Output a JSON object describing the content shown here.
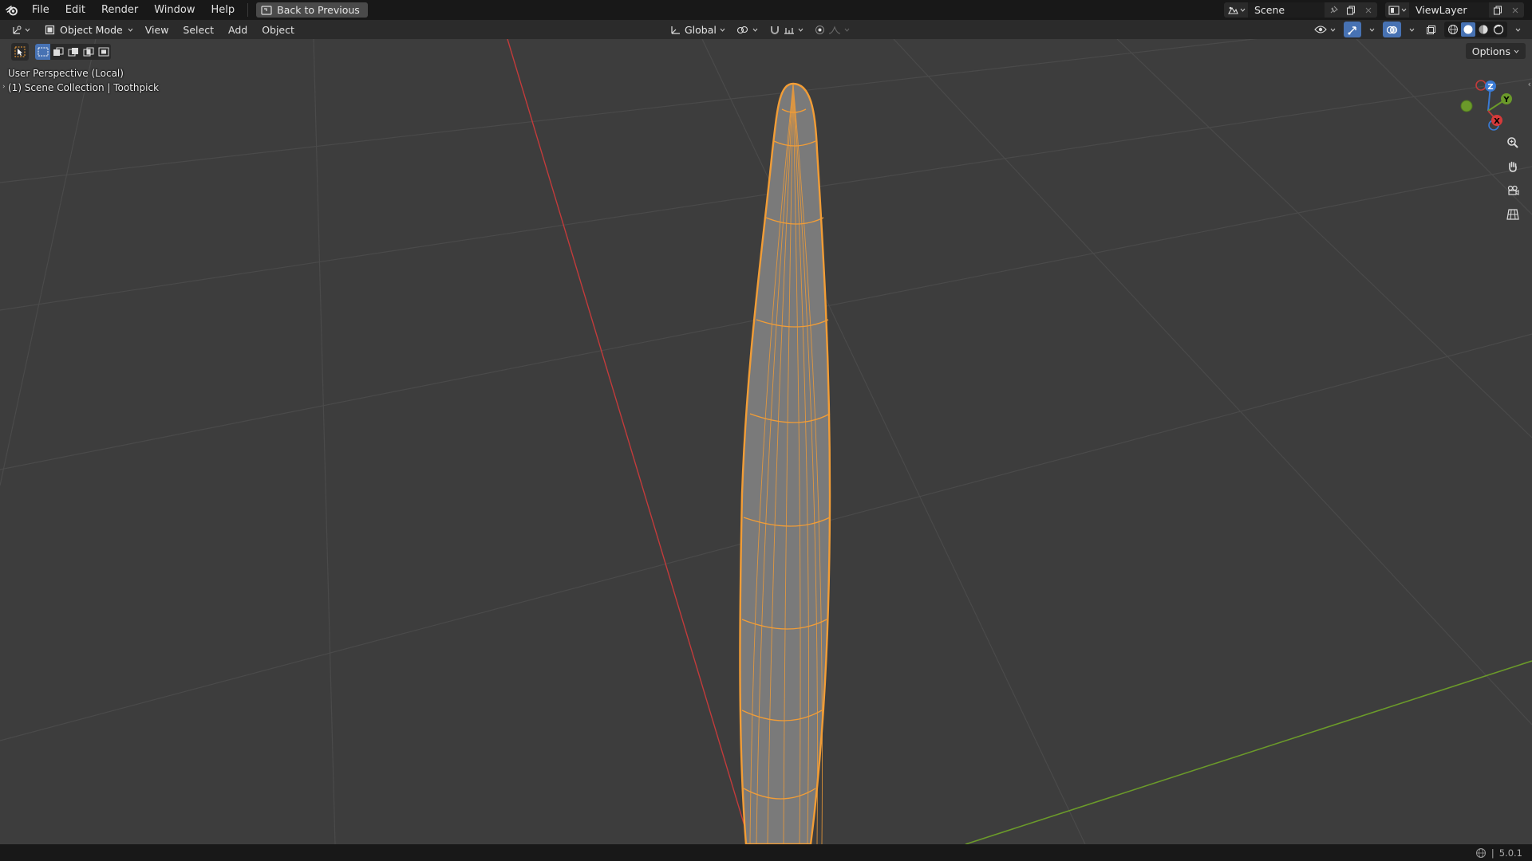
{
  "topbar": {
    "menus": [
      "File",
      "Edit",
      "Render",
      "Window",
      "Help"
    ],
    "back_button": "Back to Previous",
    "scene_name": "Scene",
    "view_layer_name": "ViewLayer"
  },
  "header": {
    "mode": "Object Mode",
    "menus": [
      "View",
      "Select",
      "Add",
      "Object"
    ],
    "transform_orientation": "Global"
  },
  "viewport": {
    "perspective_label": "User Perspective (Local)",
    "collection_label": "(1) Scene Collection | Toothpick",
    "options_label": "Options",
    "gizmo": {
      "z": "Z",
      "y": "Y",
      "x": "X"
    },
    "axis_colors": {
      "x": "#c23b3b",
      "y": "#6b9a2a",
      "z": "#3a7bd5"
    },
    "selection_color": "#f29d36"
  },
  "statusbar": {
    "version": "5.0.1"
  },
  "icons": {
    "logo": "blender-logo-icon",
    "zoom": "zoom-icon",
    "pan": "hand-icon",
    "camera": "camera-icon",
    "ortho": "grid-icon"
  }
}
